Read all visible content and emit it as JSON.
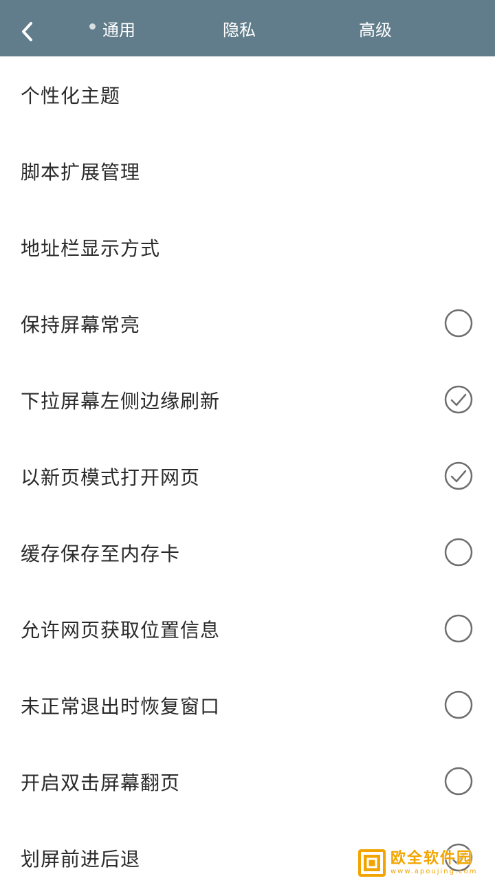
{
  "colors": {
    "header_bg": "#617d8b",
    "check_stroke": "#6e6e6e",
    "watermark": "#f2a400"
  },
  "header": {
    "back_icon": "chevron-left-icon",
    "tabs": [
      {
        "label": "通用",
        "active": true
      },
      {
        "label": "隐私",
        "active": false
      },
      {
        "label": "高级",
        "active": false
      }
    ]
  },
  "settings": {
    "items": [
      {
        "label": "个性化主题",
        "has_toggle": false
      },
      {
        "label": "脚本扩展管理",
        "has_toggle": false
      },
      {
        "label": "地址栏显示方式",
        "has_toggle": false
      },
      {
        "label": "保持屏幕常亮",
        "has_toggle": true,
        "checked": false
      },
      {
        "label": "下拉屏幕左侧边缘刷新",
        "has_toggle": true,
        "checked": true
      },
      {
        "label": "以新页模式打开网页",
        "has_toggle": true,
        "checked": true
      },
      {
        "label": "缓存保存至内存卡",
        "has_toggle": true,
        "checked": false
      },
      {
        "label": "允许网页获取位置信息",
        "has_toggle": true,
        "checked": false
      },
      {
        "label": "未正常退出时恢复窗口",
        "has_toggle": true,
        "checked": false
      },
      {
        "label": "开启双击屏幕翻页",
        "has_toggle": true,
        "checked": false
      },
      {
        "label": "划屏前进后退",
        "has_toggle": true,
        "checked": true
      }
    ]
  },
  "watermark": {
    "title": "欧全软件园",
    "subtitle": "www.apoujing.com"
  }
}
